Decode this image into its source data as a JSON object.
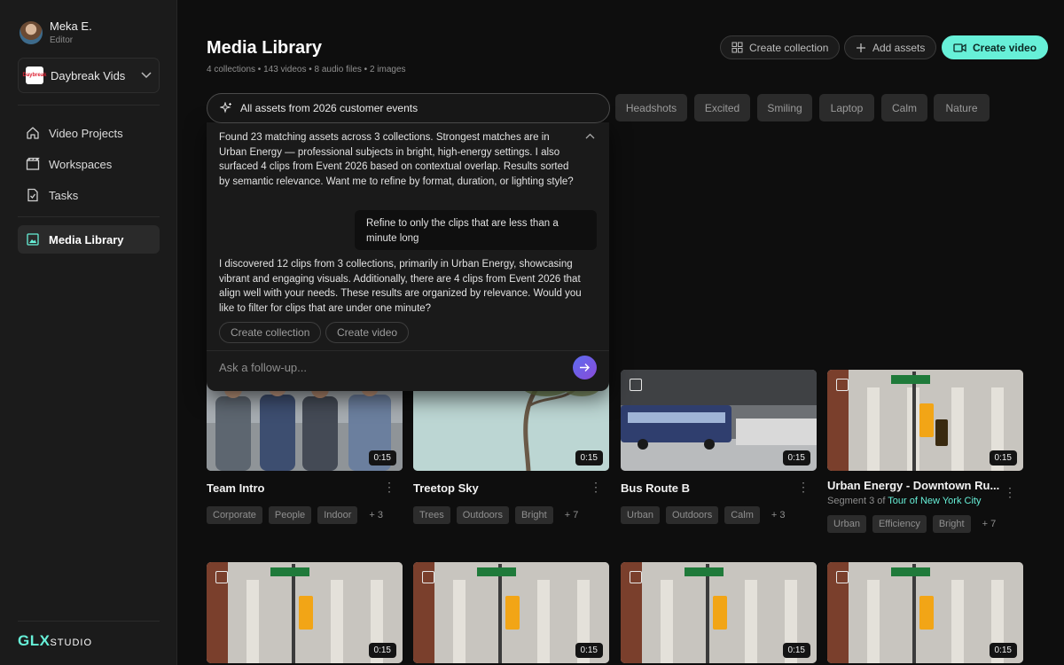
{
  "user": {
    "name": "Meka E.",
    "role": "Editor"
  },
  "workspace": {
    "name": "Daybreak Vids",
    "logo_text": "Daybreak"
  },
  "nav": [
    {
      "label": "Video Projects",
      "icon": "home-icon"
    },
    {
      "label": "Workspaces",
      "icon": "clapperboard-icon"
    },
    {
      "label": "Tasks",
      "icon": "task-doc-icon"
    },
    {
      "label": "Media Library",
      "icon": "image-icon",
      "active": true
    }
  ],
  "brand": {
    "accent": "GLX",
    "rest": "STUDIO"
  },
  "header": {
    "title": "Media Library",
    "subtitle": "4 collections • 143 videos • 8 audio files • 2 images",
    "create_collection": "Create collection",
    "add_assets": "Add assets",
    "create_video": "Create video"
  },
  "filters": [
    "Headshots",
    "Excited",
    "Smiling",
    "Laptop",
    "Calm",
    "Nature"
  ],
  "ai": {
    "query": "All assets from 2026 customer events",
    "response1": "Found 23 matching assets across 3 collections. Strongest matches are in Urban Energy — professional subjects in bright, high-energy settings. I also surfaced 4 clips from Event 2026 based on contextual overlap. Results sorted by semantic relevance. Want me to refine by format, duration, or lighting style?",
    "user_msg": "Refine to only the clips that are less than a minute long",
    "response2": "I discovered 12 clips from 3 collections, primarily in Urban Energy, showcasing vibrant and engaging visuals. Additionally, there are 4 clips from Event 2026 that align well with your needs. These results are organized by relevance. Would you like to filter for clips that are under one minute?",
    "action_collection": "Create collection",
    "action_video": "Create video",
    "placeholder": "Ask a follow-up..."
  },
  "cards": [
    {
      "title": "Team Intro",
      "duration": "0:15",
      "tags": [
        "Corporate",
        "People",
        "Indoor"
      ],
      "more": "+ 3"
    },
    {
      "title": "Treetop Sky",
      "duration": "0:15",
      "tags": [
        "Trees",
        "Outdoors",
        "Bright"
      ],
      "more": "+ 7"
    },
    {
      "title": "Bus Route B",
      "duration": "0:15",
      "tags": [
        "Urban",
        "Outdoors",
        "Calm"
      ],
      "more": "+ 3"
    },
    {
      "title": "Urban Energy - Downtown Ru...",
      "duration": "0:15",
      "segment_prefix": "Segment 3 of",
      "segment_link": "Tour of New York City",
      "tags": [
        "Urban",
        "Efficiency",
        "Bright"
      ],
      "more": "+ 7"
    }
  ],
  "row2_durations": [
    "0:15",
    "0:15",
    "0:15",
    "0:15"
  ],
  "colors": {
    "accent": "#67f0d8",
    "background": "#0e0e0e",
    "sidebar": "#1b1b1b"
  }
}
